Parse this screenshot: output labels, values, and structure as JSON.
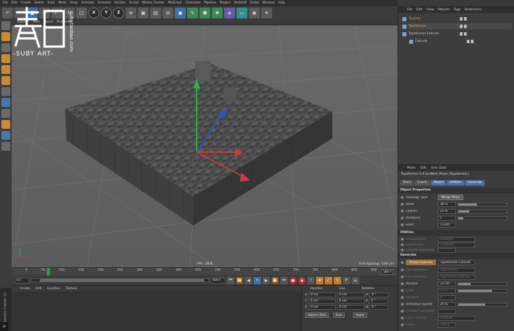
{
  "app": {
    "menu": [
      "File",
      "Edit",
      "Create",
      "Select",
      "Tools",
      "Mesh",
      "Snap",
      "Animate",
      "Simulate",
      "Render",
      "Sculpt",
      "Motion Tracker",
      "MoGraph",
      "Character",
      "Pipeline",
      "Plugins",
      "Redshift",
      "Script",
      "Window",
      "Help"
    ]
  },
  "toolbar": {
    "axis_x": "X",
    "axis_y": "Y",
    "axis_z": "Z"
  },
  "viewport": {
    "menu": [
      "Display",
      "Filter",
      "Panel",
      "ProRender"
    ],
    "fps": "FPS : 28.8",
    "grid_spacing": "Grid Spacing : 100 cm"
  },
  "timeline": {
    "ticks": [
      "0",
      "50",
      "100",
      "150",
      "200",
      "250",
      "300",
      "350",
      "400",
      "450",
      "500",
      "550",
      "600",
      "650",
      "700",
      "750",
      "800",
      "850",
      "900"
    ],
    "current_frame": "100 F",
    "cursor_fraction": 0.06
  },
  "transport": {
    "start": "0 F",
    "end": "900 F"
  },
  "material_manager": {
    "menu": [
      "Create",
      "Edit",
      "Function",
      "Texture"
    ]
  },
  "coordinates": {
    "headers": [
      "Position",
      "Size",
      "Rotation"
    ],
    "rows": [
      {
        "axis": "X",
        "pos": "0 cm",
        "size": "0 cm",
        "rot_label": "H",
        "rot": "0 °"
      },
      {
        "axis": "Y",
        "pos": "0 cm",
        "size": "0 cm",
        "rot_label": "P",
        "rot": "0 °"
      },
      {
        "axis": "Z",
        "pos": "0 cm",
        "size": "0 cm",
        "rot_label": "B",
        "rot": "0 °"
      }
    ],
    "mode": "Object (Rel)",
    "size_mode": "Size",
    "apply": "Apply"
  },
  "object_manager": {
    "menu": [
      "File",
      "Edit",
      "View",
      "Objects",
      "Tags",
      "Bookmarks"
    ],
    "items": [
      {
        "name": "Topgrey",
        "indent": 0,
        "dim": true
      },
      {
        "name": "Topoformer",
        "indent": 0,
        "dim": false,
        "selected": true
      },
      {
        "name": "Topoformer Extrude",
        "indent": 0,
        "dim": false
      },
      {
        "name": "Extrude",
        "indent": 1,
        "dim": false
      }
    ]
  },
  "attributes": {
    "menu": [
      "Mode",
      "Edit",
      "User Data"
    ],
    "title": "Topoformer 0.4 by Merk Vilson [Topoformer]",
    "tabs": [
      {
        "label": "Basic",
        "on": false
      },
      {
        "label": "Coord.",
        "on": false
      },
      {
        "label": "Object",
        "on": true
      },
      {
        "label": "Utilities",
        "on": true
      },
      {
        "label": "Generate",
        "on": true
      }
    ],
    "object_properties": "Object Properties",
    "topology_type_label": "Topology Type",
    "topology_type_value": "Merge Polys",
    "params": [
      {
        "label": "Delta",
        "value": "38 %",
        "fill": 0.38
      },
      {
        "label": "Epsilon",
        "value": "23 %",
        "fill": 0.23
      },
      {
        "label": "Iterations",
        "value": "5",
        "fill": 0.1
      },
      {
        "label": "Seed",
        "value": "12345",
        "fill": null
      }
    ],
    "utilities": "Utilities",
    "util_rows": [
      {
        "label": "Triangulation",
        "value": "Disabled"
      },
      {
        "label": "Subdivision",
        "value": "Disabled"
      },
      {
        "label": "Explode Segments",
        "value": ""
      }
    ],
    "generate": "Generate",
    "motion_extrude_label": "Motion Extrude",
    "motion_extrude_value": "Topoformer Extrude",
    "gen_rows": [
      {
        "label": "Link Deformer",
        "value": "Topoformer",
        "dim": true
      },
      {
        "label": "Link Effectors",
        "value": "Topoformer Extrude",
        "dim": true
      },
      {
        "label": "Position",
        "value": "22 cm",
        "fill": 0.25,
        "dim": false
      },
      {
        "label": "Scale",
        "value": "72 %",
        "fill": 0.7,
        "dim": true
      },
      {
        "label": "Rotation",
        "value": "0 °",
        "fill": null,
        "dim": true
      },
      {
        "label": "Animation Speed",
        "value": "29 %",
        "fill": 0.55,
        "dim": false
      },
      {
        "label": "Fracture Generator",
        "value": "",
        "fill": null,
        "dim": true
      },
      {
        "label": "Link Fracture",
        "value": "Fracture",
        "fill": null,
        "dim": true
      },
      {
        "label": "Game",
        "value": "100 %",
        "fill": null,
        "dim": true
      }
    ]
  },
  "watermark": {
    "brand": "-SUBY ART-",
    "url": "suby.taobao.com"
  },
  "sidetag": ">",
  "maxon": "MAXON CINEMA 4D"
}
